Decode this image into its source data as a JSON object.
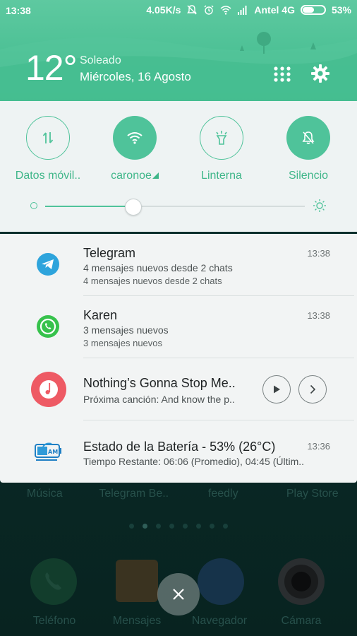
{
  "status_bar": {
    "time": "13:38",
    "speed": "4.05K/s",
    "carrier": "Antel 4G",
    "battery_pct": "53%",
    "battery_level": 0.53
  },
  "weather": {
    "temperature": "12°",
    "condition": "Soleado",
    "date": "Miércoles, 16 Agosto"
  },
  "quick_settings": {
    "toggles": [
      {
        "label": "Datos móvil..",
        "icon": "data-arrows-icon",
        "state": "off"
      },
      {
        "label": "caronoe",
        "icon": "wifi-icon",
        "state": "on"
      },
      {
        "label": "Linterna",
        "icon": "flashlight-icon",
        "state": "off"
      },
      {
        "label": "Silencio",
        "icon": "bell-off-icon",
        "state": "on"
      }
    ],
    "brightness_level": 0.34
  },
  "notifications": [
    {
      "app": "Telegram",
      "title": "Telegram",
      "time": "13:38",
      "line1": "4 mensajes nuevos desde 2 chats",
      "line2": "4 mensajes nuevos desde 2 chats",
      "icon": "telegram-icon"
    },
    {
      "app": "WhatsApp",
      "title": "Karen",
      "time": "13:38",
      "line1": "3 mensajes nuevos",
      "line2": "3 mensajes nuevos",
      "icon": "whatsapp-icon"
    },
    {
      "app": "Música",
      "title": "Nothing’s Gonna Stop Me..",
      "line1": "Próxima canción: And know the p..",
      "icon": "music-note-icon"
    },
    {
      "app": "Battery",
      "title": "Estado de la Batería - 53% (26°C)",
      "time": "13:36",
      "line1": "Tiempo Restante: 06:06 (Promedio), 04:45 (Últim..",
      "icon": "battery-monitor-icon"
    }
  ],
  "home": {
    "row_labels": [
      "Música",
      "Telegram Be..",
      "feedly",
      "Play Store"
    ],
    "dock_labels": [
      "Teléfono",
      "Mensajes",
      "Navegador",
      "Cámara"
    ]
  },
  "colors": {
    "accent": "#4fc39a",
    "header_top": "#5ec9a0",
    "header_bottom": "#3dba8c"
  }
}
